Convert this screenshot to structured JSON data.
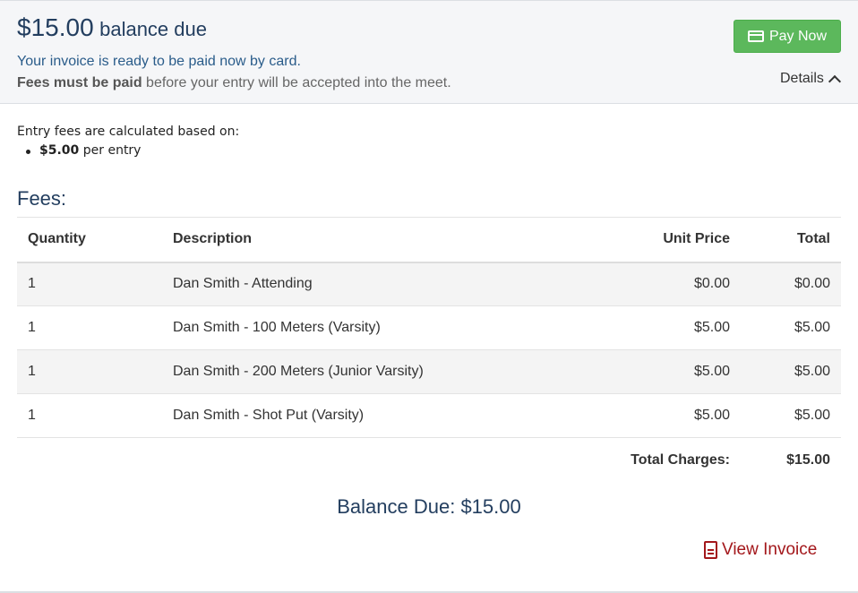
{
  "header": {
    "balance_amount": "$15.00",
    "balance_label": "balance due",
    "ready_text": "Your invoice is ready to be paid now by card.",
    "fees_bold": "Fees must be paid",
    "fees_rest": " before your entry will be accepted into the meet.",
    "pay_button": "Pay Now",
    "details_label": "Details"
  },
  "calc": {
    "intro": "Entry fees are calculated based on:",
    "item_amount": "$5.00",
    "item_unit": " per entry"
  },
  "fees": {
    "title": "Fees:",
    "columns": {
      "quantity": "Quantity",
      "description": "Description",
      "unit_price": "Unit Price",
      "total": "Total"
    },
    "rows": [
      {
        "quantity": "1",
        "description": "Dan Smith - Attending",
        "unit_price": "$0.00",
        "total": "$0.00"
      },
      {
        "quantity": "1",
        "description": "Dan Smith - 100 Meters (Varsity)",
        "unit_price": "$5.00",
        "total": "$5.00"
      },
      {
        "quantity": "1",
        "description": "Dan Smith - 200 Meters (Junior Varsity)",
        "unit_price": "$5.00",
        "total": "$5.00"
      },
      {
        "quantity": "1",
        "description": "Dan Smith - Shot Put (Varsity)",
        "unit_price": "$5.00",
        "total": "$5.00"
      }
    ],
    "total_label": "Total Charges:",
    "total_value": "$15.00"
  },
  "balance_due": "Balance Due: $15.00",
  "view_invoice": "View Invoice",
  "colors": {
    "primary_text": "#233e5f",
    "pay_button": "#5cb85c",
    "invoice_link": "#a3171b"
  },
  "icons": {
    "pay": "credit-card-icon",
    "details": "chevron-up-icon",
    "invoice": "file-text-icon"
  }
}
